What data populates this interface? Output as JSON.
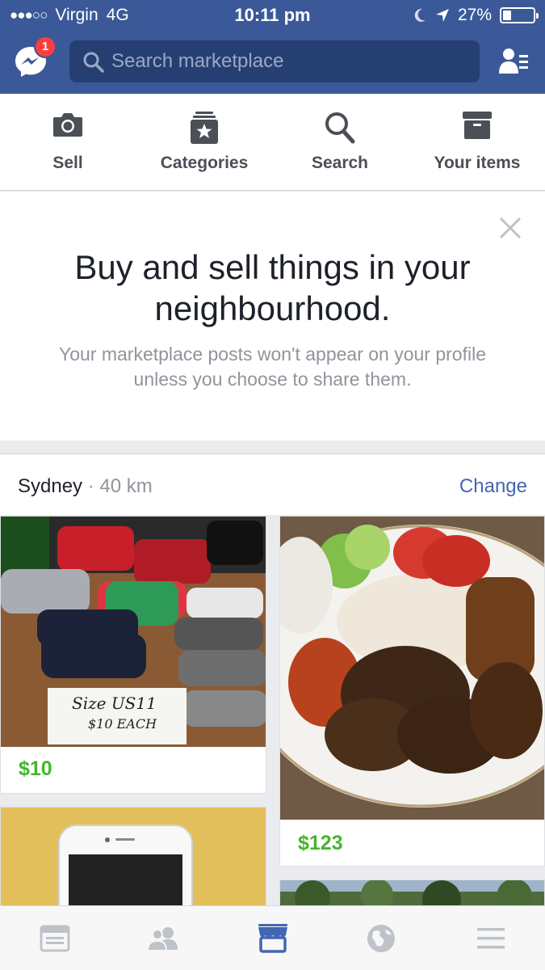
{
  "status_bar": {
    "carrier": "Virgin",
    "network": "4G",
    "time": "10:11 pm",
    "battery": "27%",
    "battery_level": 0.27
  },
  "header": {
    "messenger_badge": "1",
    "search_placeholder": "Search marketplace",
    "brand_color": "#3b5998"
  },
  "actions": [
    {
      "label": "Sell",
      "icon": "camera-icon"
    },
    {
      "label": "Categories",
      "icon": "categories-icon"
    },
    {
      "label": "Search",
      "icon": "search-icon"
    },
    {
      "label": "Your items",
      "icon": "archive-box-icon"
    }
  ],
  "promo": {
    "title": "Buy and sell things in your neighbourhood.",
    "subtitle": "Your marketplace posts won't appear on your profile unless you choose to share them."
  },
  "location": {
    "city": "Sydney",
    "separator": "·",
    "distance": "40 km",
    "change_label": "Change"
  },
  "listings": [
    {
      "price": "$10",
      "image": "shoes-photo",
      "sign_line1": "Size US11",
      "sign_line2": "$10 EACH"
    },
    {
      "price": "$123",
      "image": "food-plate-photo"
    },
    {
      "price": "",
      "image": "phone-photo"
    },
    {
      "price": "",
      "image": "trees-photo"
    }
  ],
  "tabs": [
    {
      "name": "news-feed-icon"
    },
    {
      "name": "friends-icon"
    },
    {
      "name": "marketplace-icon",
      "active": true
    },
    {
      "name": "notifications-globe-icon"
    },
    {
      "name": "menu-icon"
    }
  ],
  "colors": {
    "price_green": "#42b72a",
    "link_blue": "#4267b2",
    "active_tab": "#4267b2"
  }
}
